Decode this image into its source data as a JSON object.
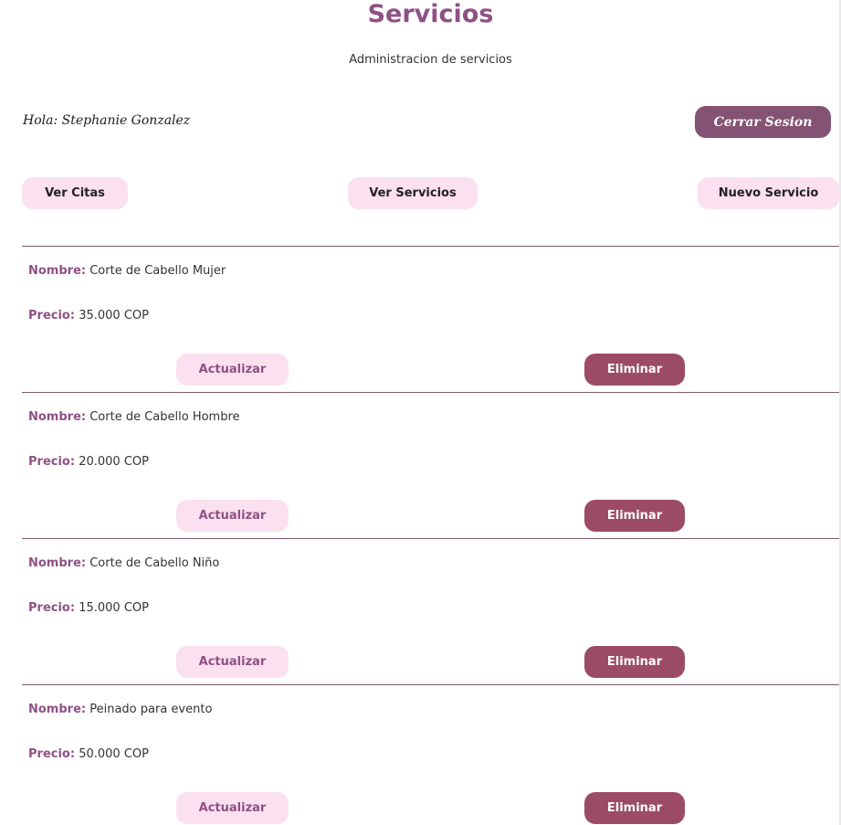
{
  "header": {
    "title": "Servicios",
    "subtitle": "Administracion de servicios"
  },
  "user": {
    "greeting": "Hola: Stephanie Gonzalez",
    "logout_label": "Cerrar Sesion"
  },
  "nav": {
    "ver_citas": "Ver Citas",
    "ver_servicios": "Ver Servicios",
    "nuevo_servicio": "Nuevo Servicio"
  },
  "labels": {
    "nombre": "Nombre:",
    "precio": "Precio:",
    "actualizar": "Actualizar",
    "eliminar": "Eliminar"
  },
  "services": [
    {
      "nombre": "Corte de Cabello Mujer",
      "precio": "35.000 COP"
    },
    {
      "nombre": "Corte de Cabello Hombre",
      "precio": "20.000 COP"
    },
    {
      "nombre": "Corte de Cabello Niño",
      "precio": "15.000 COP"
    },
    {
      "nombre": "Peinado para evento",
      "precio": "50.000 COP"
    }
  ],
  "colors": {
    "accent": "#8f5185",
    "logout_button": "#845373",
    "light_button": "#fbe0ef",
    "delete_button": "#9c4b67",
    "divider": "#7b5a70"
  }
}
